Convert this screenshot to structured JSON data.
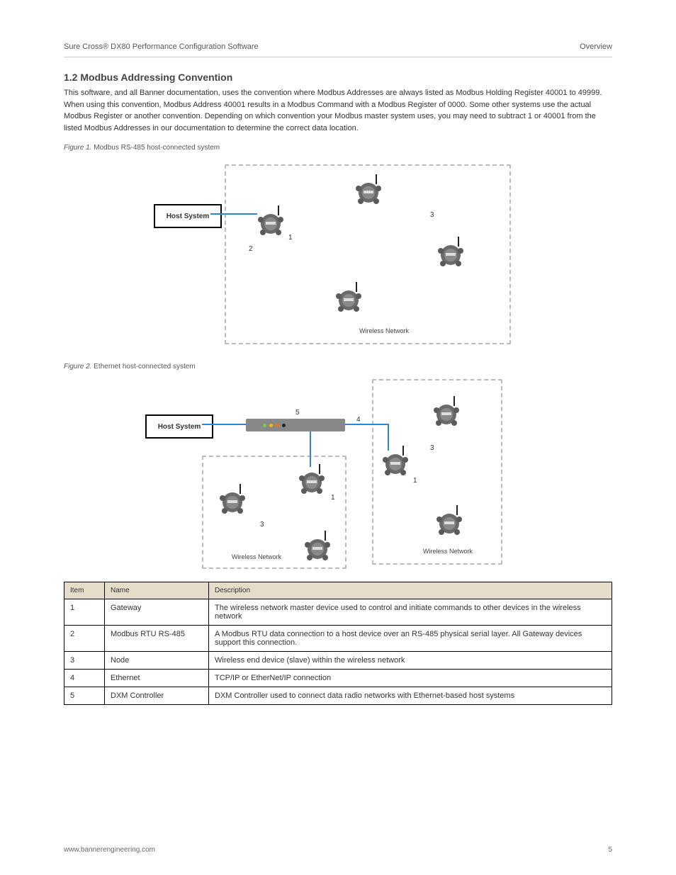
{
  "header": {
    "left": "Sure Cross® DX80 Performance Configuration Software",
    "right": "Overview"
  },
  "section": {
    "title": "1.2  Modbus Addressing Convention",
    "para1": "This software, and all Banner documentation, uses the convention where Modbus Addresses are always listed as Modbus Holding Register 40001 to 49999. When using this convention, Modbus Address 40001 results in a Modbus Command with a Modbus Register of 0000. Some other systems use the actual Modbus Register or another convention. Depending on which convention your Modbus master system uses, you may need to subtract 1 or 40001 from the listed Modbus Addresses in our documentation to determine the correct data location.",
    "fig1_caption_num": "Figure 1.",
    "fig1_caption_text": " Modbus RS-485 host-connected system",
    "fig2_caption_num": "Figure 2.",
    "fig2_caption_text": " Ethernet host-connected system"
  },
  "diagram": {
    "host_label": "Host System",
    "wireless_network_label": "Wireless Network",
    "fig1_labels": {
      "one": "1",
      "two": "2",
      "three": "3"
    },
    "fig2_labels": {
      "one": "1",
      "three": "3",
      "four": "4",
      "five": "5"
    }
  },
  "table": {
    "headers": {
      "item": "Item",
      "name": "Name",
      "description": "Description"
    },
    "rows": [
      {
        "item": "1",
        "name": "Gateway",
        "description": "The wireless network master device used to control and initiate commands to other devices in the wireless network"
      },
      {
        "item": "2",
        "name": "Modbus RTU RS-485",
        "description": "A Modbus RTU data connection to a host device over an RS-485 physical serial layer. All Gateway devices support this connection."
      },
      {
        "item": "3",
        "name": "Node",
        "description": "Wireless end device (slave) within the wireless network"
      },
      {
        "item": "4",
        "name": "Ethernet",
        "description": "TCP/IP or EtherNet/IP connection"
      },
      {
        "item": "5",
        "name": "DXM Controller",
        "description": "DXM Controller used to connect data radio networks with Ethernet-based host systems"
      }
    ]
  },
  "footer": {
    "left": "www.bannerengineering.com",
    "right": "5"
  }
}
